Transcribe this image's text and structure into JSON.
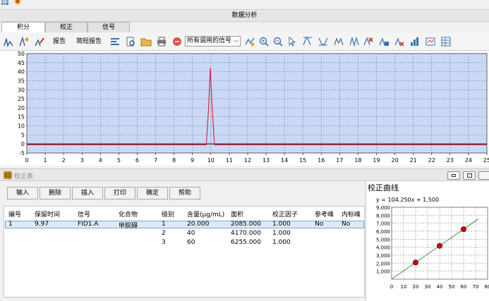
{
  "window": {
    "title": "数据分析"
  },
  "tabs": [
    {
      "label": "积分",
      "active": true
    },
    {
      "label": "校正",
      "active": false
    },
    {
      "label": "信号",
      "active": false
    }
  ],
  "toolbar": {
    "report_label": "报告",
    "brief_report_label": "简短报告",
    "signal_select_value": "所有调用的信号"
  },
  "chart_data": [
    {
      "type": "line",
      "x_ticks": [
        "0",
        "1",
        "2",
        "3",
        "4",
        "5",
        "6",
        "7",
        "8",
        "9",
        "10",
        "11",
        "12",
        "13",
        "14",
        "15",
        "16",
        "17",
        "18",
        "19",
        "20",
        "21",
        "22",
        "23",
        "24",
        "25"
      ],
      "y_ticks": [
        "50",
        "45",
        "40",
        "35",
        "30",
        "25",
        "20",
        "15",
        "10",
        "5",
        "0",
        "-5"
      ],
      "xlim": [
        0,
        25
      ],
      "ylim": [
        -5,
        50
      ],
      "grid": true,
      "series": [
        {
          "x": [
            0,
            9.75,
            9.88,
            9.97,
            10.07,
            10.2,
            25
          ],
          "y": [
            -0.5,
            -0.5,
            20,
            42,
            20,
            -0.5,
            -0.5
          ],
          "color": "#d81b3c"
        }
      ]
    },
    {
      "type": "scatter",
      "title": "校正曲线",
      "equation": "y = 104.250x + 1.500",
      "x_ticks": [
        "0",
        "10",
        "20",
        "30",
        "40",
        "50",
        "60",
        "70",
        "80"
      ],
      "y_ticks": [
        "9,000",
        "8,000",
        "7,000",
        "6,000",
        "5,000",
        "4,000",
        "3,000",
        "2,000",
        "1,000"
      ],
      "xlim": [
        0,
        80
      ],
      "ylim": [
        0,
        9000
      ],
      "grid": true,
      "points": [
        {
          "x": 20,
          "y": 2085
        },
        {
          "x": 40,
          "y": 4170
        },
        {
          "x": 60,
          "y": 6255
        }
      ],
      "fit": {
        "slope": 104.25,
        "intercept": 1.5
      }
    }
  ],
  "calibration": {
    "window_title": "校正表",
    "buttons": [
      "输入",
      "删除",
      "插入",
      "打印",
      "确定",
      "帮助"
    ],
    "headers": [
      "编号",
      "保留时间",
      "信号",
      "化合物",
      "级别",
      "含量(μg/mL)",
      "面积",
      "校正因子",
      "参考峰",
      "内标峰"
    ],
    "rows": [
      [
        "1",
        "9.97",
        "FID1.A",
        "甲脘碍",
        "1",
        "20.000",
        "2085.000",
        "1.000",
        "No",
        "No"
      ],
      [
        "",
        "",
        "",
        "",
        "2",
        "40",
        "4170.000",
        "1.000",
        "",
        ""
      ],
      [
        "",
        "",
        "",
        "",
        "3",
        "60",
        "6255.000",
        "1.000",
        "",
        ""
      ]
    ]
  }
}
